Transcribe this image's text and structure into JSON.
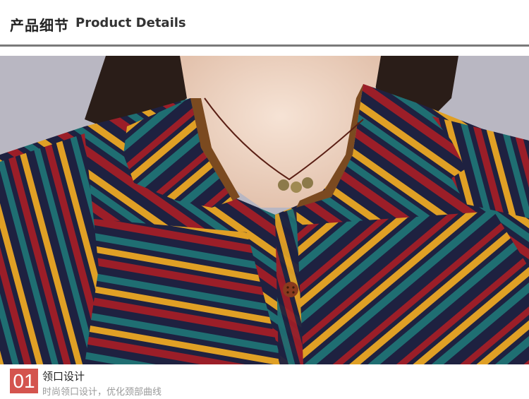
{
  "header": {
    "title_cn": "产品细节",
    "title_en": "Product Details"
  },
  "photo": {
    "subject": "collar-closeup",
    "colors": {
      "navy": "#1e2140",
      "red": "#9b1e28",
      "teal": "#1f6e72",
      "mustard": "#e0a025",
      "collar": "#7b4a20",
      "skin": "#f1d9c8",
      "hair": "#2a1d18",
      "background": "#b9b7c2"
    }
  },
  "feature": {
    "number": "01",
    "title": "领口设计",
    "description": "时尚领口设计，优化颈部曲线",
    "badge_color": "#d4544e"
  }
}
